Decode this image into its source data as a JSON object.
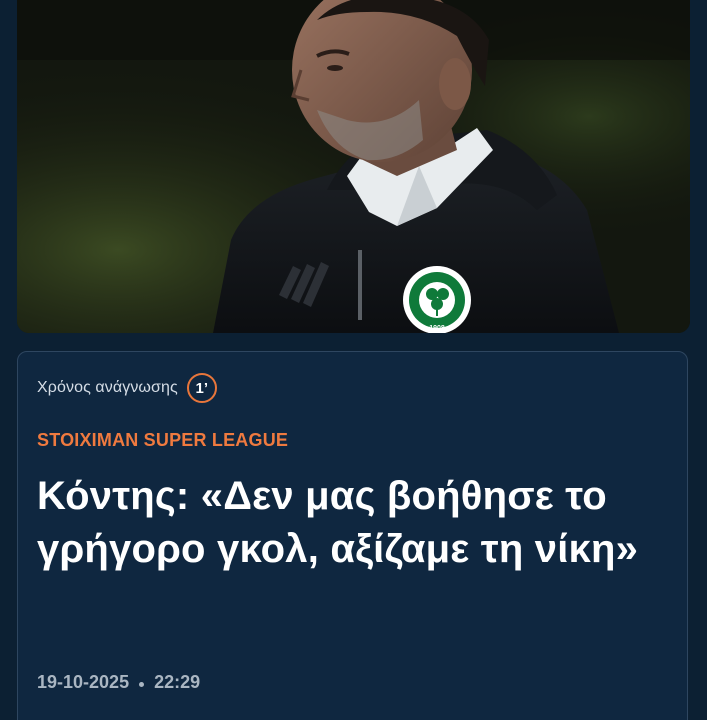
{
  "hero": {
    "image_alt": "Coach portrait",
    "crest_icon": "clover-crest-icon"
  },
  "article": {
    "reading_time_label": "Χρόνος ανάγνωσης",
    "reading_time_value": "1’",
    "category": "STOIXIMAN SUPER LEAGUE",
    "headline": "Κόντης: «Δεν μας βοήθησε το γρήγορο γκολ, αξίζαμε τη νίκη»",
    "date": "19-10-2025",
    "time": "22:29"
  },
  "colors": {
    "background": "#0c2033",
    "card": "#0f2740",
    "accent": "#ef7a3f",
    "headline": "#ffffff",
    "meta": "#aab6c2"
  }
}
